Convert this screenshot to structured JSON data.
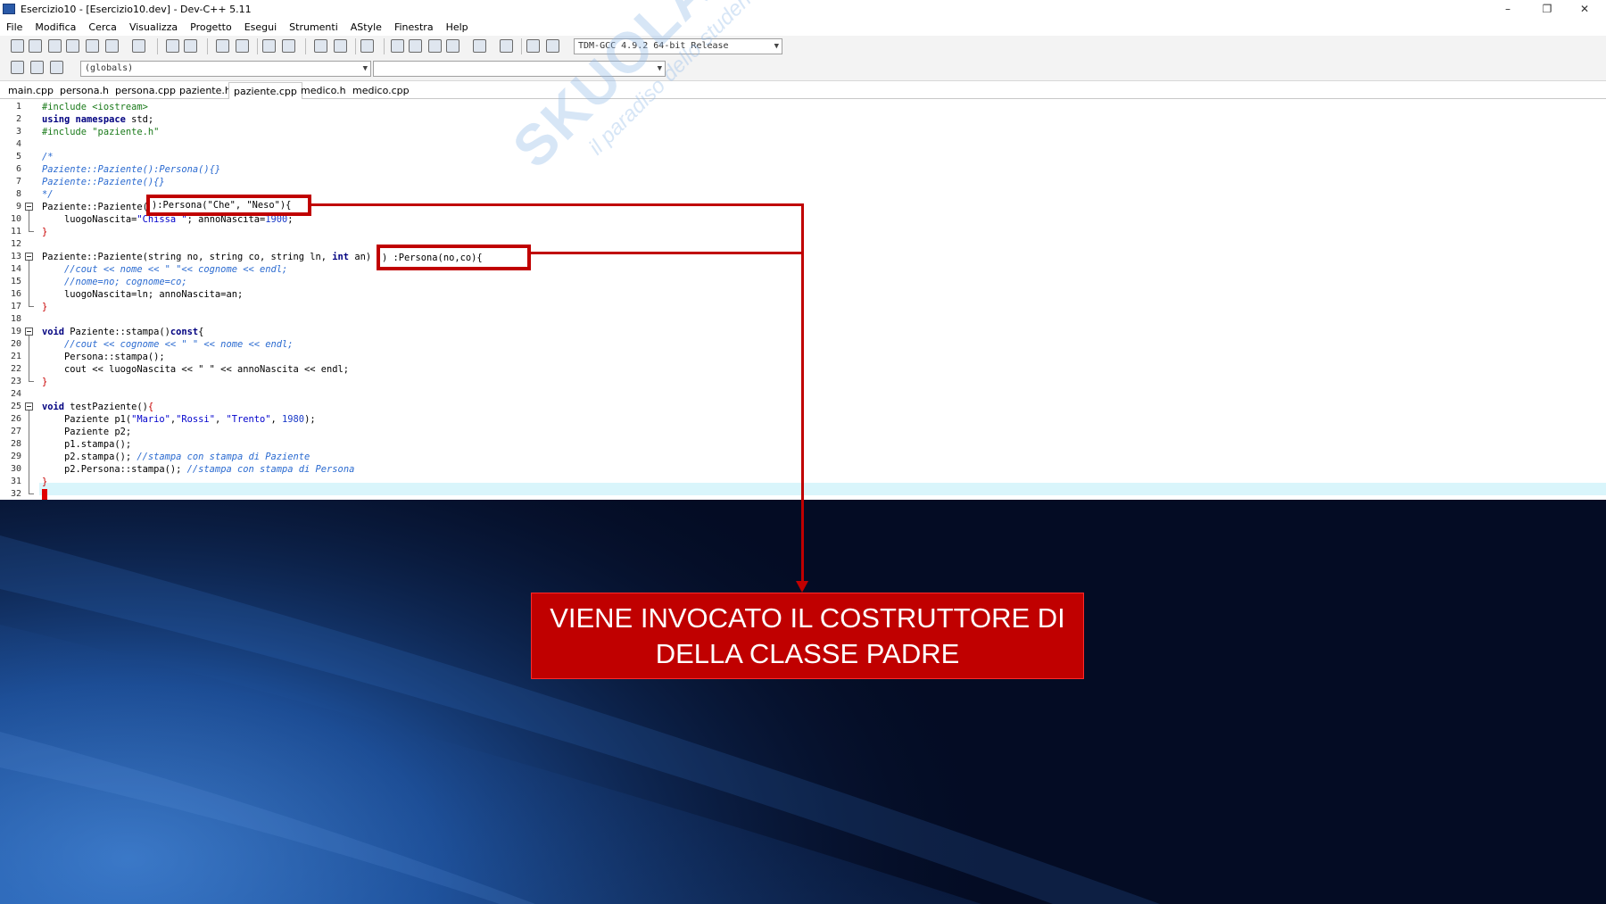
{
  "window": {
    "title": "Esercizio10 - [Esercizio10.dev] - Dev-C++ 5.11",
    "controls": [
      "–",
      "❐",
      "✕"
    ]
  },
  "menu": [
    "File",
    "Modifica",
    "Cerca",
    "Visualizza",
    "Progetto",
    "Esegui",
    "Strumenti",
    "AStyle",
    "Finestra",
    "Help"
  ],
  "toolbar": {
    "compiler_select": "TDM-GCC 4.9.2 64-bit Release",
    "scope_select": "(globals)",
    "member_select": ""
  },
  "tabs": [
    "main.cpp",
    "persona.h",
    "persona.cpp",
    "paziente.h",
    "paziente.cpp",
    "medico.h",
    "medico.cpp"
  ],
  "active_tab": "paziente.cpp",
  "code_lines": [
    "#include <iostream>",
    "using namespace std;",
    "#include \"paziente.h\"",
    "",
    "/*",
    "Paziente::Paziente():Persona(){}",
    "Paziente::Paziente(){}",
    "*/",
    "Paziente::Paziente():Persona(\"Che\", \"Neso\"){",
    "    luogoNascita=\"Chissa \"; annoNascita=1900;",
    "}",
    "",
    "Paziente::Paziente(string no, string co, string ln, int an) :Persona(no,co){",
    "    //cout << nome << \" \"<< cognome << endl;",
    "    //nome=no; cognome=co;",
    "    luogoNascita=ln; annoNascita=an;",
    "}",
    "",
    "void Paziente::stampa()const{",
    "    //cout << cognome << \" \" << nome << endl;",
    "    Persona::stampa();",
    "    cout << luogoNascita << \" \" << annoNascita << endl;",
    "}",
    "",
    "void testPaziente(){",
    "    Paziente p1(\"Mario\",\"Rossi\", \"Trento\", 1980);",
    "    Paziente p2;",
    "    p1.stampa();",
    "    p2.stampa(); //stampa con stampa di Paziente",
    "    p2.Persona::stampa(); //stampa con stampa di Persona",
    "}",
    ""
  ],
  "highlights": {
    "first": "):Persona(\"Che\", \"Neso\"){",
    "second": ") :Persona(no,co){"
  },
  "callout": {
    "line1": "VIENE INVOCATO IL COSTRUTTORE DI",
    "line2": "DELLA CLASSE PADRE"
  },
  "watermark": {
    "brand": "SKUOLA.net",
    "tagline": "il paradiso dello studente"
  },
  "colors": {
    "accent_red": "#c00000",
    "background_dark": "#040c24",
    "keyword": "#000080",
    "comment": "#2a6ad0",
    "preprocessor": "#1a7a1a"
  }
}
